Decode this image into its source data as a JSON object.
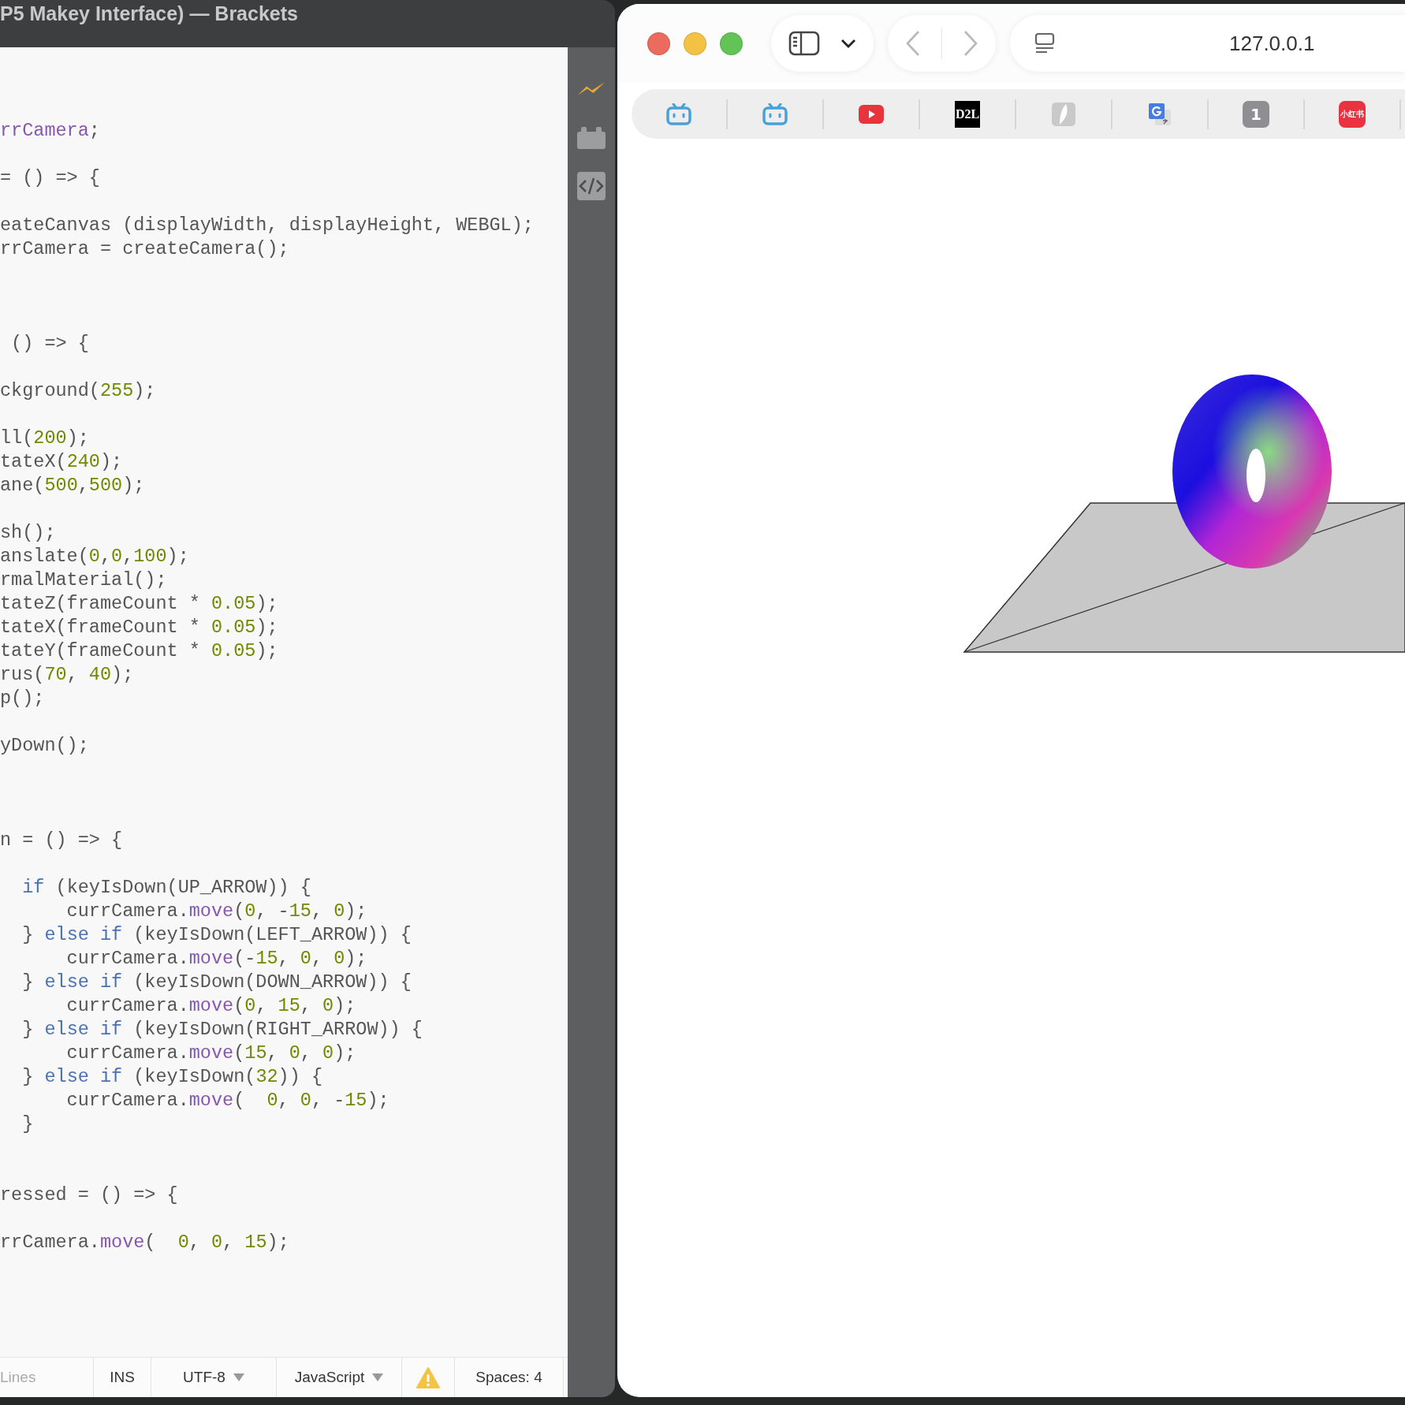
{
  "editor": {
    "title": "P5 Makey Interface) — Brackets",
    "code_lines": [
      {
        "kind": "code",
        "tokens": [
          {
            "text": "rrCamera",
            "kind": "def"
          },
          {
            "text": ";",
            "kind": "plain"
          }
        ]
      },
      {
        "kind": "blank"
      },
      {
        "kind": "code",
        "tokens": [
          {
            "text": "= () => {",
            "kind": "plain"
          }
        ]
      },
      {
        "kind": "blank"
      },
      {
        "kind": "code",
        "tokens": [
          {
            "text": "eateCanvas (displayWidth, displayHeight, WEBGL);",
            "kind": "plain"
          }
        ]
      },
      {
        "kind": "code",
        "tokens": [
          {
            "text": "rrCamera = createCamera();",
            "kind": "plain"
          }
        ]
      },
      {
        "kind": "blank"
      },
      {
        "kind": "blank"
      },
      {
        "kind": "blank"
      },
      {
        "kind": "code",
        "tokens": [
          {
            "text": " () => {",
            "kind": "plain"
          }
        ]
      },
      {
        "kind": "blank"
      },
      {
        "kind": "code",
        "tokens": [
          {
            "text": "ckground(",
            "kind": "plain"
          },
          {
            "text": "255",
            "kind": "number"
          },
          {
            "text": ");",
            "kind": "plain"
          }
        ]
      },
      {
        "kind": "blank"
      },
      {
        "kind": "code",
        "tokens": [
          {
            "text": "ll(",
            "kind": "plain"
          },
          {
            "text": "200",
            "kind": "number"
          },
          {
            "text": ");",
            "kind": "plain"
          }
        ]
      },
      {
        "kind": "code",
        "tokens": [
          {
            "text": "tateX(",
            "kind": "plain"
          },
          {
            "text": "240",
            "kind": "number"
          },
          {
            "text": ");",
            "kind": "plain"
          }
        ]
      },
      {
        "kind": "code",
        "tokens": [
          {
            "text": "ane(",
            "kind": "plain"
          },
          {
            "text": "500",
            "kind": "number"
          },
          {
            "text": ",",
            "kind": "plain"
          },
          {
            "text": "500",
            "kind": "number"
          },
          {
            "text": ");",
            "kind": "plain"
          }
        ]
      },
      {
        "kind": "blank"
      },
      {
        "kind": "code",
        "tokens": [
          {
            "text": "sh();",
            "kind": "plain"
          }
        ]
      },
      {
        "kind": "code",
        "tokens": [
          {
            "text": "anslate(",
            "kind": "plain"
          },
          {
            "text": "0",
            "kind": "number"
          },
          {
            "text": ",",
            "kind": "plain"
          },
          {
            "text": "0",
            "kind": "number"
          },
          {
            "text": ",",
            "kind": "plain"
          },
          {
            "text": "100",
            "kind": "number"
          },
          {
            "text": ");",
            "kind": "plain"
          }
        ]
      },
      {
        "kind": "code",
        "tokens": [
          {
            "text": "rmalMaterial();",
            "kind": "plain"
          }
        ]
      },
      {
        "kind": "code",
        "tokens": [
          {
            "text": "tateZ(frameCount * ",
            "kind": "plain"
          },
          {
            "text": "0.05",
            "kind": "number"
          },
          {
            "text": ");",
            "kind": "plain"
          }
        ]
      },
      {
        "kind": "code",
        "tokens": [
          {
            "text": "tateX(frameCount * ",
            "kind": "plain"
          },
          {
            "text": "0.05",
            "kind": "number"
          },
          {
            "text": ");",
            "kind": "plain"
          }
        ]
      },
      {
        "kind": "code",
        "tokens": [
          {
            "text": "tateY(frameCount * ",
            "kind": "plain"
          },
          {
            "text": "0.05",
            "kind": "number"
          },
          {
            "text": ");",
            "kind": "plain"
          }
        ]
      },
      {
        "kind": "code",
        "tokens": [
          {
            "text": "rus(",
            "kind": "plain"
          },
          {
            "text": "70",
            "kind": "number"
          },
          {
            "text": ", ",
            "kind": "plain"
          },
          {
            "text": "40",
            "kind": "number"
          },
          {
            "text": ");",
            "kind": "plain"
          }
        ]
      },
      {
        "kind": "code",
        "tokens": [
          {
            "text": "p();",
            "kind": "plain"
          }
        ]
      },
      {
        "kind": "blank"
      },
      {
        "kind": "code",
        "tokens": [
          {
            "text": "yDown();",
            "kind": "plain"
          }
        ]
      },
      {
        "kind": "blank"
      },
      {
        "kind": "blank"
      },
      {
        "kind": "blank"
      },
      {
        "kind": "code",
        "tokens": [
          {
            "text": "n = () => {",
            "kind": "plain"
          }
        ]
      },
      {
        "kind": "blank"
      },
      {
        "kind": "code",
        "tokens": [
          {
            "text": "  if",
            "kind": "keyword"
          },
          {
            "text": " (keyIsDown(UP_ARROW)) {",
            "kind": "plain"
          }
        ]
      },
      {
        "kind": "code",
        "tokens": [
          {
            "text": "      currCamera.",
            "kind": "plain"
          },
          {
            "text": "move",
            "kind": "def"
          },
          {
            "text": "(",
            "kind": "plain"
          },
          {
            "text": "0",
            "kind": "number"
          },
          {
            "text": ", -",
            "kind": "plain"
          },
          {
            "text": "15",
            "kind": "number"
          },
          {
            "text": ", ",
            "kind": "plain"
          },
          {
            "text": "0",
            "kind": "number"
          },
          {
            "text": ");",
            "kind": "plain"
          }
        ]
      },
      {
        "kind": "code",
        "tokens": [
          {
            "text": "  } ",
            "kind": "plain"
          },
          {
            "text": "else if",
            "kind": "keyword"
          },
          {
            "text": " (keyIsDown(LEFT_ARROW)) {",
            "kind": "plain"
          }
        ]
      },
      {
        "kind": "code",
        "tokens": [
          {
            "text": "      currCamera.",
            "kind": "plain"
          },
          {
            "text": "move",
            "kind": "def"
          },
          {
            "text": "(-",
            "kind": "plain"
          },
          {
            "text": "15",
            "kind": "number"
          },
          {
            "text": ", ",
            "kind": "plain"
          },
          {
            "text": "0",
            "kind": "number"
          },
          {
            "text": ", ",
            "kind": "plain"
          },
          {
            "text": "0",
            "kind": "number"
          },
          {
            "text": ");",
            "kind": "plain"
          }
        ]
      },
      {
        "kind": "code",
        "tokens": [
          {
            "text": "  } ",
            "kind": "plain"
          },
          {
            "text": "else if",
            "kind": "keyword"
          },
          {
            "text": " (keyIsDown(DOWN_ARROW)) {",
            "kind": "plain"
          }
        ]
      },
      {
        "kind": "code",
        "tokens": [
          {
            "text": "      currCamera.",
            "kind": "plain"
          },
          {
            "text": "move",
            "kind": "def"
          },
          {
            "text": "(",
            "kind": "plain"
          },
          {
            "text": "0",
            "kind": "number"
          },
          {
            "text": ", ",
            "kind": "plain"
          },
          {
            "text": "15",
            "kind": "number"
          },
          {
            "text": ", ",
            "kind": "plain"
          },
          {
            "text": "0",
            "kind": "number"
          },
          {
            "text": ");",
            "kind": "plain"
          }
        ]
      },
      {
        "kind": "code",
        "tokens": [
          {
            "text": "  } ",
            "kind": "plain"
          },
          {
            "text": "else if",
            "kind": "keyword"
          },
          {
            "text": " (keyIsDown(RIGHT_ARROW)) {",
            "kind": "plain"
          }
        ]
      },
      {
        "kind": "code",
        "tokens": [
          {
            "text": "      currCamera.",
            "kind": "plain"
          },
          {
            "text": "move",
            "kind": "def"
          },
          {
            "text": "(",
            "kind": "plain"
          },
          {
            "text": "15",
            "kind": "number"
          },
          {
            "text": ", ",
            "kind": "plain"
          },
          {
            "text": "0",
            "kind": "number"
          },
          {
            "text": ", ",
            "kind": "plain"
          },
          {
            "text": "0",
            "kind": "number"
          },
          {
            "text": ");",
            "kind": "plain"
          }
        ]
      },
      {
        "kind": "code",
        "tokens": [
          {
            "text": "  } ",
            "kind": "plain"
          },
          {
            "text": "else if",
            "kind": "keyword"
          },
          {
            "text": " (keyIsDown(",
            "kind": "plain"
          },
          {
            "text": "32",
            "kind": "number"
          },
          {
            "text": ")) {",
            "kind": "plain"
          }
        ]
      },
      {
        "kind": "code",
        "tokens": [
          {
            "text": "      currCamera.",
            "kind": "plain"
          },
          {
            "text": "move",
            "kind": "def"
          },
          {
            "text": "(  ",
            "kind": "plain"
          },
          {
            "text": "0",
            "kind": "number"
          },
          {
            "text": ", ",
            "kind": "plain"
          },
          {
            "text": "0",
            "kind": "number"
          },
          {
            "text": ", -",
            "kind": "plain"
          },
          {
            "text": "15",
            "kind": "number"
          },
          {
            "text": ");",
            "kind": "plain"
          }
        ]
      },
      {
        "kind": "code",
        "tokens": [
          {
            "text": "  }",
            "kind": "plain"
          }
        ]
      },
      {
        "kind": "blank"
      },
      {
        "kind": "blank"
      },
      {
        "kind": "code",
        "tokens": [
          {
            "text": "ressed = () => {",
            "kind": "plain"
          }
        ]
      },
      {
        "kind": "blank"
      },
      {
        "kind": "code",
        "tokens": [
          {
            "text": "rrCamera.",
            "kind": "plain"
          },
          {
            "text": "move",
            "kind": "def"
          },
          {
            "text": "(  ",
            "kind": "plain"
          },
          {
            "text": "0",
            "kind": "number"
          },
          {
            "text": ", ",
            "kind": "plain"
          },
          {
            "text": "0",
            "kind": "number"
          },
          {
            "text": ", ",
            "kind": "plain"
          },
          {
            "text": "15",
            "kind": "number"
          },
          {
            "text": ");",
            "kind": "plain"
          }
        ]
      }
    ],
    "status_bar": {
      "lines": "Lines",
      "mode": "INS",
      "encoding": "UTF-8",
      "language": "JavaScript",
      "indent": "Spaces: 4"
    }
  },
  "browser": {
    "back": {
      "disabled": true
    },
    "forward": {
      "disabled": true
    },
    "url": "127.0.0.1",
    "favorites": [
      {
        "kind": "tv"
      },
      {
        "kind": "tv"
      },
      {
        "kind": "video"
      },
      {
        "kind": "label-dark",
        "label": "D2L"
      },
      {
        "kind": "leaf"
      },
      {
        "kind": "translate"
      },
      {
        "kind": "label-gray",
        "label": "1"
      },
      {
        "kind": "label-red",
        "label": "小红书"
      }
    ]
  }
}
